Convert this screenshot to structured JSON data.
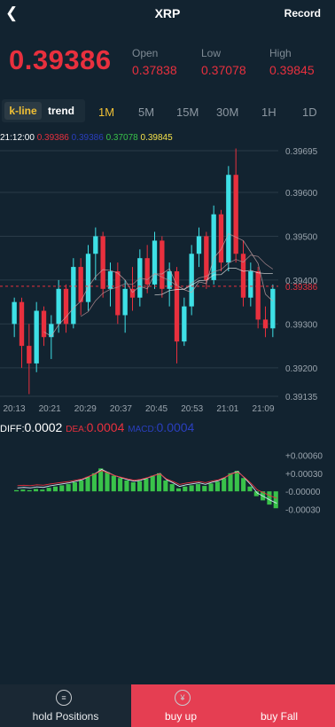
{
  "header": {
    "back_icon": "chevron-left",
    "title": "XRP",
    "record_label": "Record"
  },
  "quote": {
    "price": "0.39386",
    "open_label": "Open",
    "open": "0.37838",
    "low_label": "Low",
    "low": "0.37078",
    "high_label": "High",
    "high": "0.39845"
  },
  "chart_mode": {
    "kline_label": "k-line",
    "trend_label": "trend",
    "active": "k-line"
  },
  "intervals": {
    "items": [
      "1M",
      "5M",
      "15M",
      "30M",
      "1H",
      "1D"
    ],
    "active": "1M"
  },
  "ohlc_line": {
    "time": "21:12:00",
    "v1": "0.39386",
    "v2": "0.39386",
    "v3": "0.37078",
    "v4": "0.39845"
  },
  "macd": {
    "diff_label": "DIFF:",
    "diff": "0.0002",
    "dea_label": "DEA:",
    "dea": "0.0004",
    "macd_label": "MACD:",
    "macd": "0.0004"
  },
  "actions": {
    "hold_label": "hold Positions",
    "buy_label": "buy up",
    "sell_label": "buy Fall",
    "hold_icon": "coins-icon",
    "buy_icon": "yen-coin-icon"
  },
  "colors": {
    "up": "#3ee0e6",
    "down": "#e8303e",
    "bg": "#122330",
    "accent": "#f0c035"
  },
  "chart_data": [
    {
      "type": "candlestick",
      "ylim": [
        0.39135,
        0.39695
      ],
      "y_ticks": [
        "0.39695",
        "0.39600",
        "0.39500",
        "0.39400",
        "0.39300",
        "0.39200",
        "0.39135"
      ],
      "x_ticks": [
        "20:13",
        "20:21",
        "20:29",
        "20:37",
        "20:45",
        "20:53",
        "21:01",
        "21:09"
      ],
      "current_price_line": "0.39386",
      "candles": [
        {
          "o": 0.393,
          "h": 0.3936,
          "l": 0.3927,
          "c": 0.3935
        },
        {
          "o": 0.3935,
          "h": 0.3936,
          "l": 0.392,
          "c": 0.3925
        },
        {
          "o": 0.3925,
          "h": 0.393,
          "l": 0.3914,
          "c": 0.3921
        },
        {
          "o": 0.3921,
          "h": 0.3935,
          "l": 0.3919,
          "c": 0.3933
        },
        {
          "o": 0.3933,
          "h": 0.3934,
          "l": 0.3925,
          "c": 0.3927
        },
        {
          "o": 0.3927,
          "h": 0.3932,
          "l": 0.3922,
          "c": 0.393
        },
        {
          "o": 0.393,
          "h": 0.394,
          "l": 0.3928,
          "c": 0.3938
        },
        {
          "o": 0.3938,
          "h": 0.3939,
          "l": 0.3928,
          "c": 0.393
        },
        {
          "o": 0.393,
          "h": 0.3945,
          "l": 0.3929,
          "c": 0.3943
        },
        {
          "o": 0.3943,
          "h": 0.3945,
          "l": 0.3932,
          "c": 0.3935
        },
        {
          "o": 0.3935,
          "h": 0.3948,
          "l": 0.3933,
          "c": 0.3946
        },
        {
          "o": 0.3946,
          "h": 0.3952,
          "l": 0.394,
          "c": 0.395
        },
        {
          "o": 0.395,
          "h": 0.3951,
          "l": 0.3936,
          "c": 0.3938
        },
        {
          "o": 0.3938,
          "h": 0.3944,
          "l": 0.3934,
          "c": 0.3942
        },
        {
          "o": 0.3942,
          "h": 0.3944,
          "l": 0.393,
          "c": 0.3932
        },
        {
          "o": 0.3932,
          "h": 0.394,
          "l": 0.3928,
          "c": 0.3938
        },
        {
          "o": 0.3938,
          "h": 0.3943,
          "l": 0.3933,
          "c": 0.3936
        },
        {
          "o": 0.3936,
          "h": 0.3947,
          "l": 0.3934,
          "c": 0.3945
        },
        {
          "o": 0.3945,
          "h": 0.3948,
          "l": 0.3937,
          "c": 0.3939
        },
        {
          "o": 0.3939,
          "h": 0.3951,
          "l": 0.3938,
          "c": 0.3949
        },
        {
          "o": 0.3949,
          "h": 0.395,
          "l": 0.3936,
          "c": 0.3938
        },
        {
          "o": 0.3938,
          "h": 0.3944,
          "l": 0.3934,
          "c": 0.3942
        },
        {
          "o": 0.3942,
          "h": 0.3943,
          "l": 0.3921,
          "c": 0.3926
        },
        {
          "o": 0.3926,
          "h": 0.3936,
          "l": 0.3925,
          "c": 0.3934
        },
        {
          "o": 0.3934,
          "h": 0.3948,
          "l": 0.3932,
          "c": 0.3946
        },
        {
          "o": 0.3946,
          "h": 0.3952,
          "l": 0.3943,
          "c": 0.395
        },
        {
          "o": 0.395,
          "h": 0.3951,
          "l": 0.3938,
          "c": 0.394
        },
        {
          "o": 0.394,
          "h": 0.3957,
          "l": 0.3939,
          "c": 0.3955
        },
        {
          "o": 0.3955,
          "h": 0.3956,
          "l": 0.3942,
          "c": 0.3944
        },
        {
          "o": 0.3944,
          "h": 0.3966,
          "l": 0.3942,
          "c": 0.3964
        },
        {
          "o": 0.3964,
          "h": 0.397,
          "l": 0.3944,
          "c": 0.3946
        },
        {
          "o": 0.3946,
          "h": 0.3949,
          "l": 0.3934,
          "c": 0.3936
        },
        {
          "o": 0.3936,
          "h": 0.3944,
          "l": 0.3934,
          "c": 0.3942
        },
        {
          "o": 0.3942,
          "h": 0.3943,
          "l": 0.3929,
          "c": 0.3931
        },
        {
          "o": 0.3931,
          "h": 0.3934,
          "l": 0.3927,
          "c": 0.3929
        },
        {
          "o": 0.3929,
          "h": 0.3939,
          "l": 0.3927,
          "c": 0.3938
        }
      ]
    },
    {
      "type": "bar",
      "name_hint": "macd-histogram",
      "ylim": [
        -0.00035,
        0.00065
      ],
      "y_ticks": [
        "+0.00060",
        "+0.00030",
        "-0.00000",
        "-0.00030"
      ],
      "values": [
        2e-05,
        3e-05,
        2e-05,
        4e-05,
        3e-05,
        6e-05,
        8e-05,
        0.0001,
        0.00012,
        0.00015,
        0.00018,
        0.00024,
        0.0003,
        0.00038,
        0.00032,
        0.00026,
        0.00022,
        0.00018,
        0.00015,
        0.00017,
        0.00021,
        0.00026,
        0.0003,
        0.00018,
        0.00012,
        5e-05,
        8e-05,
        0.0001,
        0.00012,
        9e-05,
        0.00013,
        0.00016,
        0.00022,
        0.0003,
        0.00034,
        0.00022,
        8e-05,
        -8e-05,
        -0.00015,
        -0.00022,
        -0.00028
      ]
    }
  ]
}
